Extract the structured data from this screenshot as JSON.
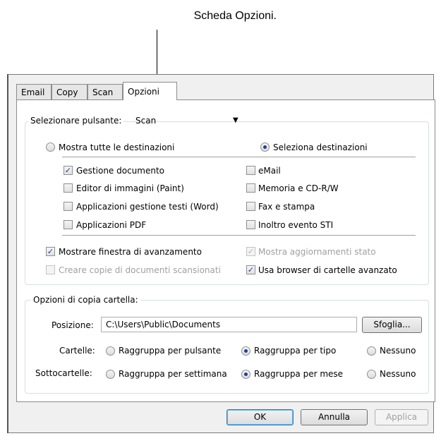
{
  "caption": "Scheda Opzioni.",
  "tabs": [
    "Email",
    "Copy",
    "Scan",
    "Opzioni"
  ],
  "select_button": {
    "label": "Selezionare pulsante:",
    "value": "Scan"
  },
  "destinations": {
    "show_all": "Mostra tutte le destinazioni",
    "select": "Seleziona destinazioni",
    "left_items": [
      "Gestione documento",
      "Editor di immagini (Paint)",
      "Applicazioni gestione testi (Word)",
      "Applicazioni  PDF"
    ],
    "right_items": [
      "eMail",
      "Memoria e CD-R/W",
      "Fax e stampa",
      "Inoltro evento STI"
    ]
  },
  "options": {
    "show_progress": "Mostrare finestra di avanzamento",
    "show_status": "Mostra aggiornamenti stato",
    "create_copies": "Creare copie di documenti scansionati",
    "advanced_browser": "Usa browser di cartelle avanzato"
  },
  "folder_copy": {
    "title": "Opzioni di copia cartella:",
    "position_label": "Posizione:",
    "position_value": "C:\\Users\\Public\\Documents",
    "browse": "Sfoglia...",
    "folders_label": "Cartelle:",
    "subfolders_label": "Sottocartelle:",
    "folders_options": [
      "Raggruppa per pulsante",
      "Raggruppa per tipo",
      "Nessuno"
    ],
    "subfolders_options": [
      "Raggruppa per settimana",
      "Raggruppa per mese",
      "Nessuno"
    ]
  },
  "footer": {
    "ok": "OK",
    "cancel": "Annulla",
    "apply": "Applica"
  },
  "colors": {
    "accent": "#1a3f9a",
    "group_border": "#d5dfe5"
  },
  "icons": {
    "checkmark": "check-icon",
    "dropdown": "dropdown-arrow-icon"
  }
}
